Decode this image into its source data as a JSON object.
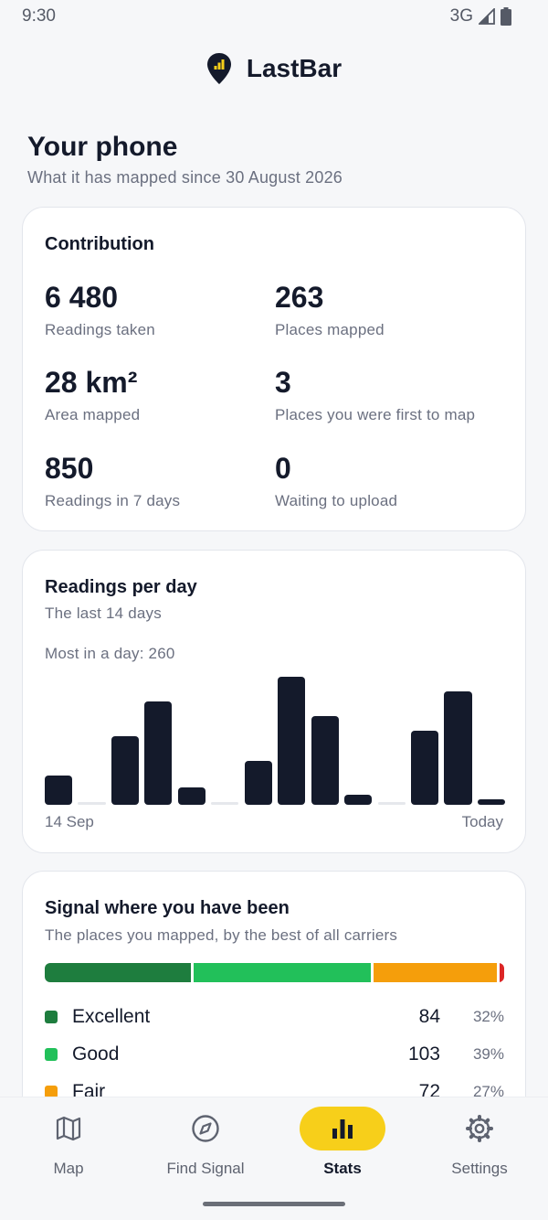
{
  "status_bar": {
    "time": "9:30",
    "network": "3G"
  },
  "app": {
    "title": "LastBar"
  },
  "page": {
    "title": "Your phone",
    "subtitle": "What it has mapped since 30 August 2026"
  },
  "contribution": {
    "title": "Contribution",
    "stats": [
      {
        "value": "6 480",
        "label": "Readings taken"
      },
      {
        "value": "263",
        "label": "Places mapped"
      },
      {
        "value": "28 km²",
        "label": "Area mapped"
      },
      {
        "value": "3",
        "label": "Places you were first to map"
      },
      {
        "value": "850",
        "label": "Readings in 7 days"
      },
      {
        "value": "0",
        "label": "Waiting to upload"
      }
    ]
  },
  "readings_per_day": {
    "title": "Readings per day",
    "subtitle": "The last 14 days",
    "max_label": "Most in a day: 260",
    "start_label": "14 Sep",
    "end_label": "Today"
  },
  "chart_data": {
    "type": "bar",
    "categories": [
      "",
      "",
      "",
      "",
      "",
      "",
      "",
      "",
      "",
      "",
      "",
      "",
      "",
      ""
    ],
    "values": [
      60,
      0,
      140,
      210,
      35,
      0,
      90,
      260,
      180,
      20,
      0,
      150,
      230,
      10
    ],
    "title": "Readings per day",
    "subtitle": "The last 14 days",
    "xlabel": "",
    "ylabel": "",
    "ylim": [
      0,
      260
    ],
    "x_tick_labels": [
      "14 Sep",
      "Today"
    ],
    "bar_color": "#141a2b",
    "grid": false
  },
  "signal": {
    "title": "Signal where you have been",
    "subtitle": "The places you mapped, by the best of all carriers",
    "levels": [
      {
        "name": "Excellent",
        "count": "84",
        "pct": "32%",
        "fraction": 0.32,
        "color": "#1e7d3e"
      },
      {
        "name": "Good",
        "count": "103",
        "pct": "39%",
        "fraction": 0.39,
        "color": "#22c05a"
      },
      {
        "name": "Fair",
        "count": "72",
        "pct": "27%",
        "fraction": 0.27,
        "color": "#f59e0b"
      },
      {
        "name": "",
        "count": "",
        "pct": "",
        "fraction": 0.01,
        "color": "#dc2626"
      }
    ]
  },
  "nav": {
    "items": [
      {
        "label": "Map",
        "icon": "map-icon"
      },
      {
        "label": "Find Signal",
        "icon": "compass-icon"
      },
      {
        "label": "Stats",
        "icon": "bar-chart-icon",
        "active": true
      },
      {
        "label": "Settings",
        "icon": "gear-icon"
      }
    ]
  },
  "colors": {
    "accent": "#f7cf1a",
    "ink": "#141a2b",
    "background": "#f6f7f9"
  }
}
